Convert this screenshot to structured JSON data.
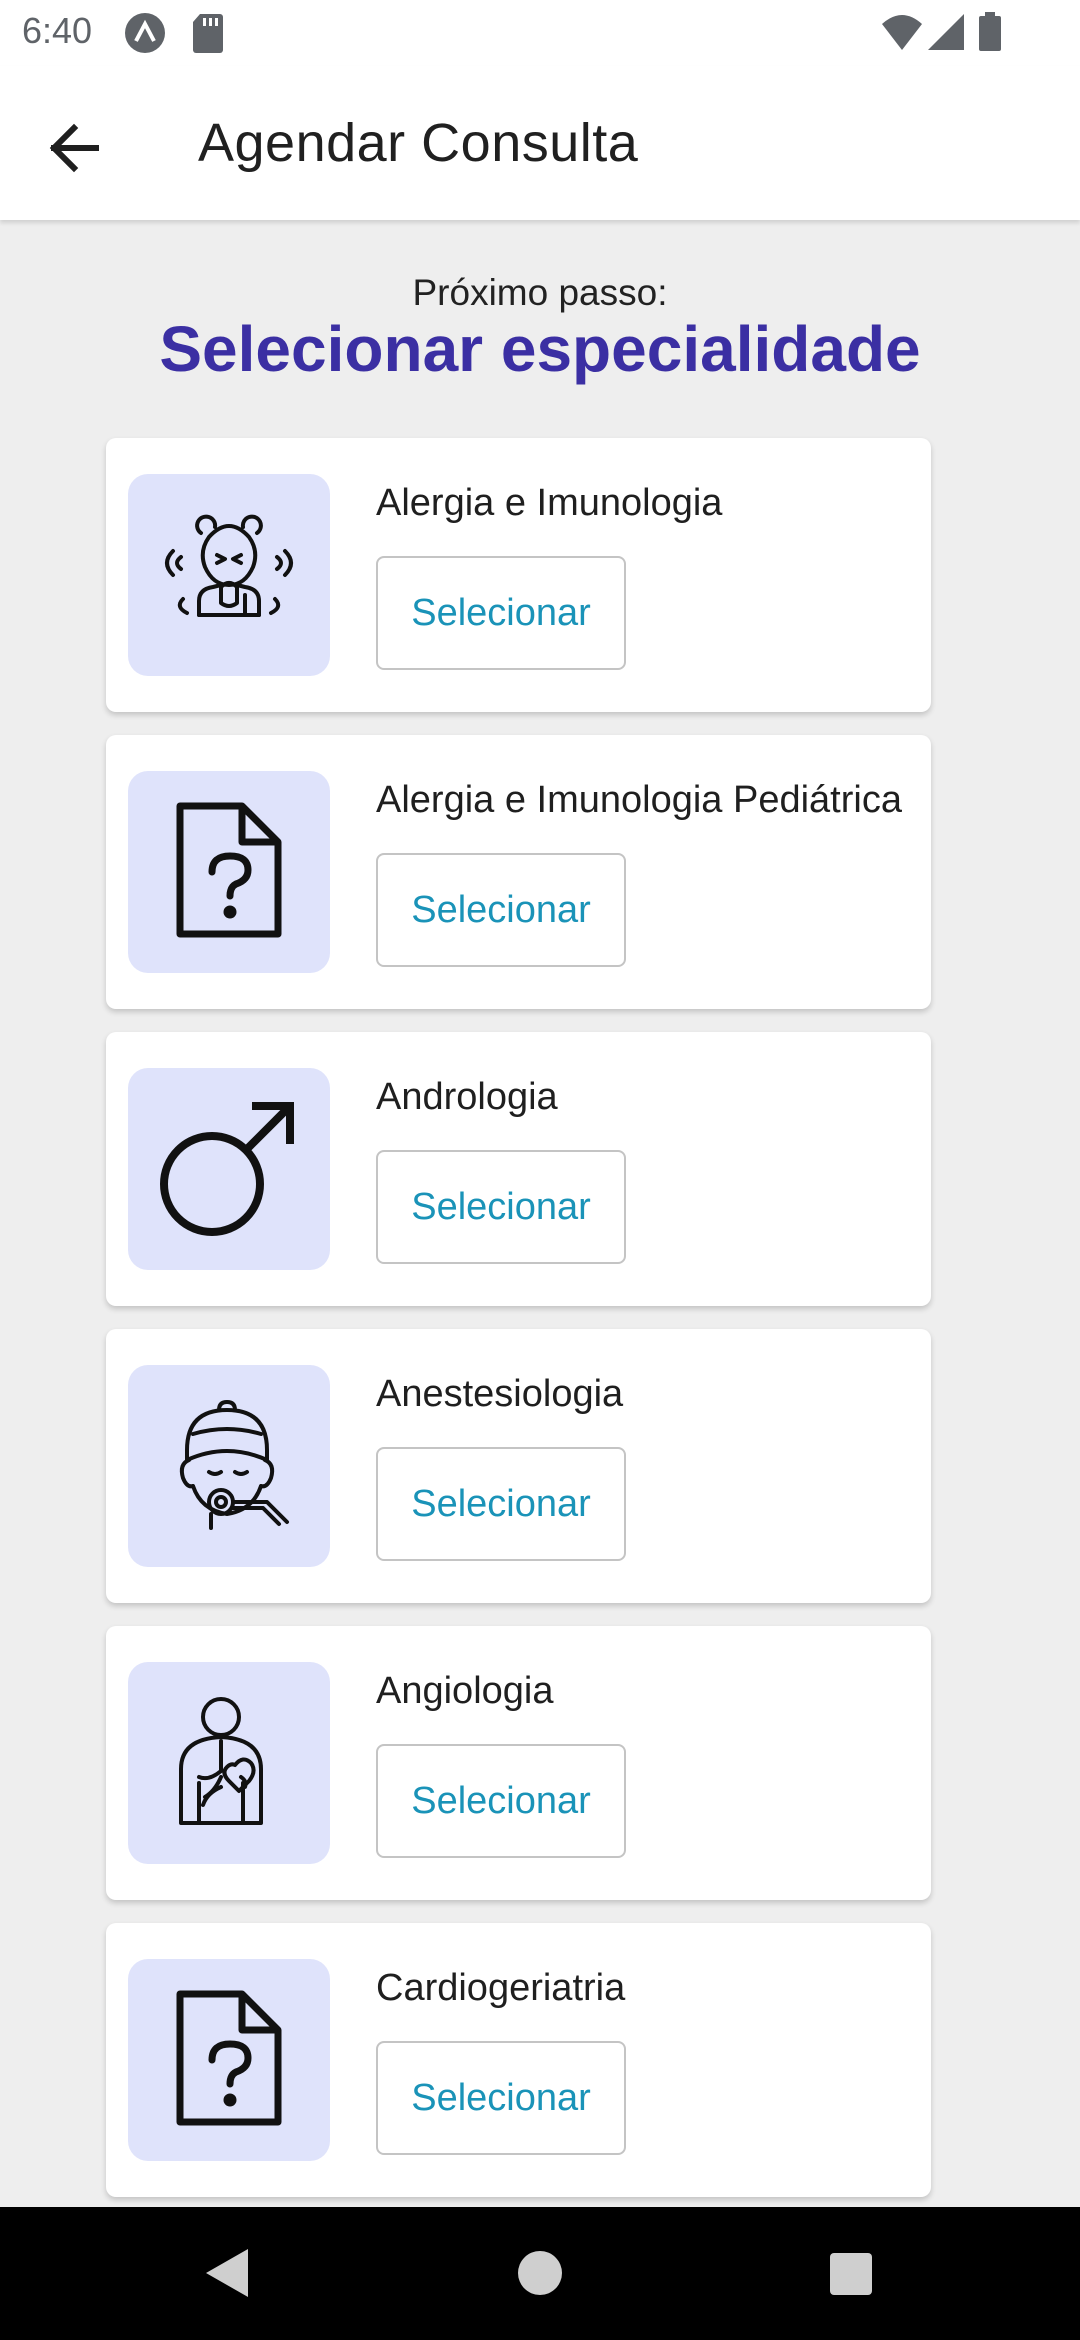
{
  "status_bar": {
    "time": "6:40",
    "icons": [
      "app-notification-icon",
      "sd-card-icon",
      "wifi-icon",
      "cellular-signal-icon",
      "battery-icon"
    ]
  },
  "app_bar": {
    "title": "Agendar Consulta",
    "back_icon": "arrow-back-icon"
  },
  "header": {
    "step_label": "Próximo passo:",
    "step_title": "Selecionar especialidade"
  },
  "colors": {
    "title_accent": "#3b2fa3",
    "button_text": "#1a93b8",
    "icon_background": "#dfe3fb"
  },
  "specialties": [
    {
      "name": "Alergia e Imunologia",
      "button": "Selecionar",
      "icon": "sneezing-person-icon"
    },
    {
      "name": "Alergia e Imunologia Pediátrica",
      "button": "Selecionar",
      "icon": "unknown-document-icon"
    },
    {
      "name": "Andrologia",
      "button": "Selecionar",
      "icon": "male-symbol-icon"
    },
    {
      "name": "Anestesiologia",
      "button": "Selecionar",
      "icon": "anesthesia-mask-icon"
    },
    {
      "name": "Angiologia",
      "button": "Selecionar",
      "icon": "body-vessels-icon"
    },
    {
      "name": "Cardiogeriatria",
      "button": "Selecionar",
      "icon": "unknown-document-icon"
    }
  ],
  "nav_bar": {
    "icons": [
      "nav-back-icon",
      "nav-home-icon",
      "nav-recents-icon"
    ]
  }
}
